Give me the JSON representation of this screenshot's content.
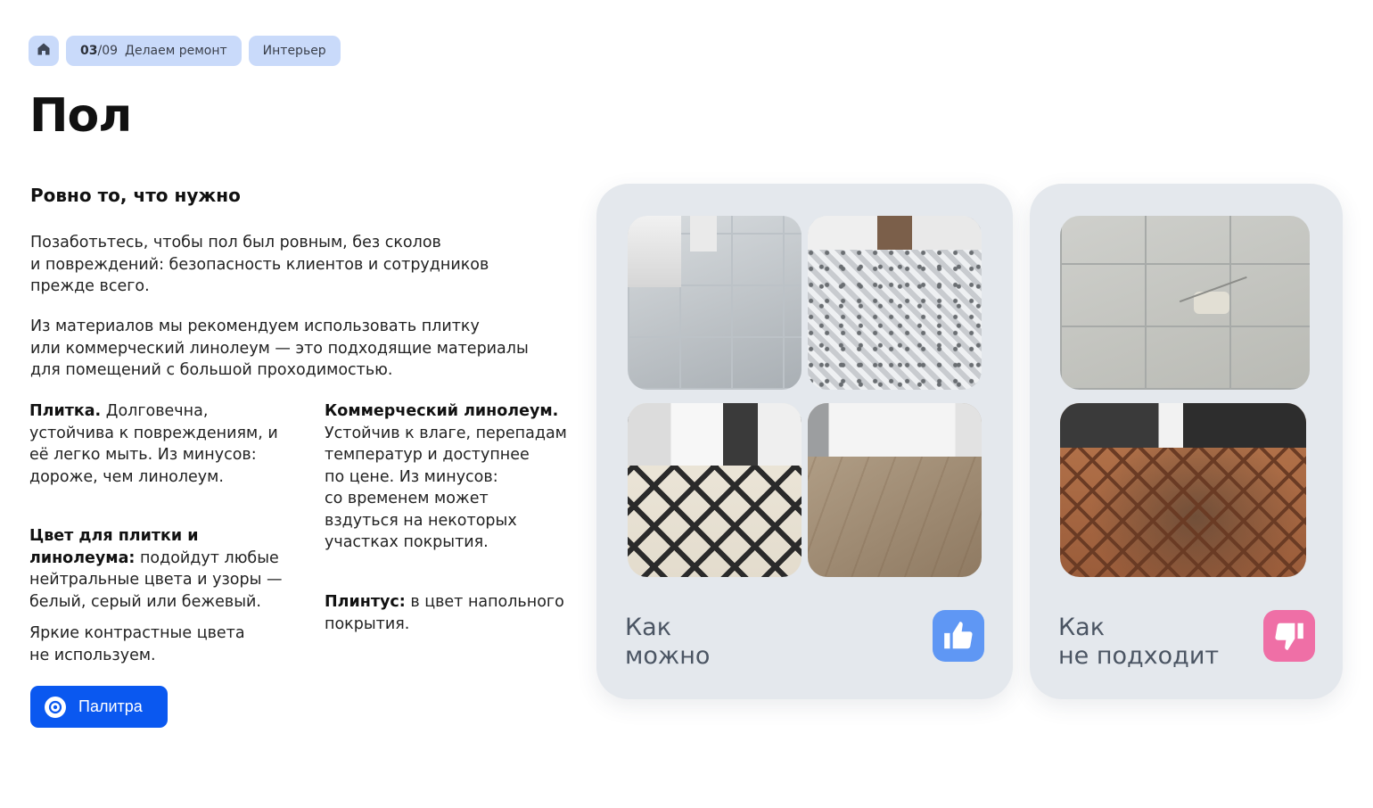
{
  "breadcrumbs": {
    "home_icon": "home-icon",
    "step_number": "03",
    "step_total": "/09",
    "step_label": "Делаем ремонт",
    "section": "Интерьер"
  },
  "page_title": "Пол",
  "subtitle": "Ровно то, что нужно",
  "paragraphs": [
    "Позаботьтесь, чтобы пол был ровным, без сколов\nи повреждений: безопасность клиентов и сотрудников\nпрежде всего.",
    "Из материалов мы рекомендуем использовать плитку\nили коммерческий линолеум — это подходящие материалы\nдля помещений с большой проходимостью."
  ],
  "tile": {
    "heading": "Плитка.",
    "text": " Долговечна, устойчива к повреждениям, и её легко мыть. Из минусов: дороже, чем линолеум."
  },
  "linoleum": {
    "heading": "Коммерческий линолеум.",
    "text": "Устойчив к влаге, перепадам\nтемператур и доступнее\nпо цене. Из минусов:\nсо временем может\nвздуться на некоторых\nучастках покрытия."
  },
  "color": {
    "heading": "Цвет для плитки и линолеума:",
    "text": " подойдут любые нейтральные цвета и узоры — белый, серый или бежевый."
  },
  "bright": "Яркие контрастные цвета\nне используем.",
  "plinth": {
    "heading": "Плинтус:",
    "text": " в цвет напольного покрытия."
  },
  "palette_button": {
    "label": "Палитра",
    "icon": "palette-icon"
  },
  "cards": {
    "good": {
      "label": "Как\nможно",
      "icon": "thumbs-up-icon",
      "color": "#5f97f4"
    },
    "bad": {
      "label": "Как\nне подходит",
      "icon": "thumbs-down-icon",
      "color": "#ef6fa6"
    }
  },
  "colors": {
    "accent": "#0a58f0",
    "crumb_bg": "#c9dafa",
    "card_bg": "#e4e8ed"
  }
}
